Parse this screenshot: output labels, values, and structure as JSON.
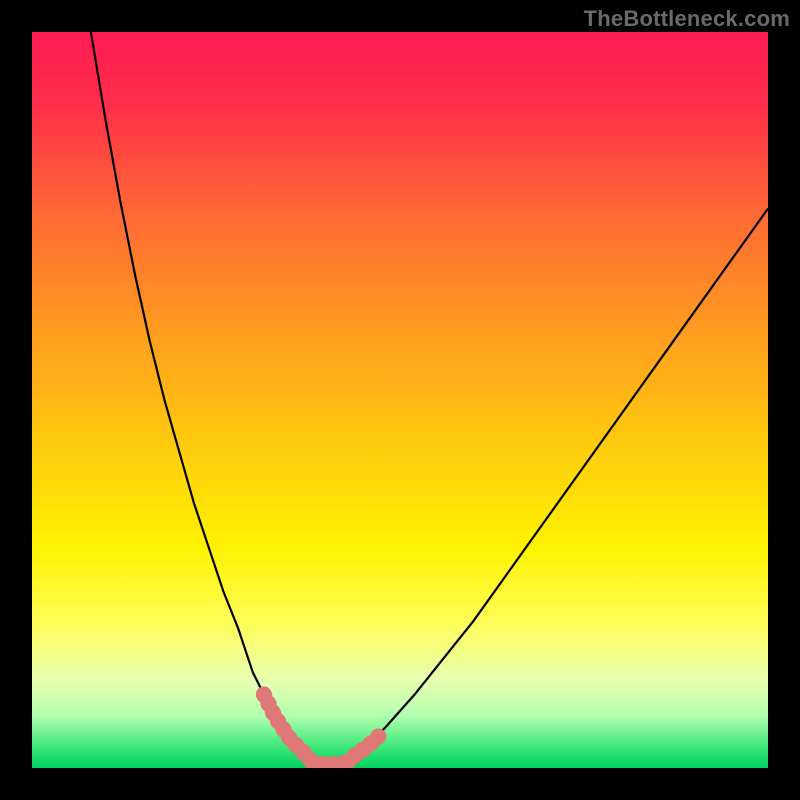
{
  "watermark": "TheBottleneck.com",
  "chart_data": {
    "type": "line",
    "title": "",
    "xlabel": "",
    "ylabel": "",
    "xlim": [
      0,
      100
    ],
    "ylim": [
      0,
      100
    ],
    "grid": false,
    "legend": false,
    "series": [
      {
        "name": "curve-left",
        "x": [
          8,
          10,
          12,
          14,
          16,
          18,
          20,
          22,
          24,
          26,
          28,
          29,
          30,
          31.5,
          33,
          35,
          37,
          38.07
        ],
        "values": [
          100,
          88,
          77,
          67,
          58,
          50,
          43,
          36,
          30,
          24,
          19,
          16,
          13,
          10,
          7,
          4,
          2,
          0.74
        ]
      },
      {
        "name": "plateau",
        "x": [
          38.07,
          39,
          40,
          41,
          42,
          42.79
        ],
        "values": [
          0.74,
          0.55,
          0.5,
          0.55,
          0.6,
          0.74
        ]
      },
      {
        "name": "curve-right",
        "x": [
          42.79,
          45,
          48,
          52,
          56,
          60,
          65,
          70,
          75,
          80,
          85,
          90,
          95,
          100
        ],
        "values": [
          0.74,
          2.5,
          5.5,
          10,
          15,
          20,
          27,
          34,
          41,
          48,
          55,
          62,
          69,
          76
        ]
      },
      {
        "name": "highlight-left",
        "x": [
          31.5,
          33,
          35,
          37,
          38.07
        ],
        "values": [
          10,
          7,
          4,
          2,
          0.74
        ]
      },
      {
        "name": "highlight-bottom",
        "x": [
          38.07,
          39,
          40,
          41,
          42,
          42.79
        ],
        "values": [
          0.74,
          0.55,
          0.5,
          0.55,
          0.6,
          0.74
        ]
      },
      {
        "name": "highlight-right",
        "x": [
          42.79,
          44,
          45,
          46,
          47,
          47.22
        ],
        "values": [
          0.74,
          1.8,
          2.5,
          3.3,
          4.2,
          4.55
        ]
      }
    ],
    "background_gradient": {
      "stops": [
        {
          "offset": 0.0,
          "color": "#ff1a54"
        },
        {
          "offset": 0.1,
          "color": "#ff2f4a"
        },
        {
          "offset": 0.25,
          "color": "#ff6a34"
        },
        {
          "offset": 0.4,
          "color": "#ff9a20"
        },
        {
          "offset": 0.55,
          "color": "#ffc80e"
        },
        {
          "offset": 0.7,
          "color": "#fff200"
        },
        {
          "offset": 0.8,
          "color": "#fffd55"
        },
        {
          "offset": 0.88,
          "color": "#e8ffb0"
        },
        {
          "offset": 0.93,
          "color": "#b0ffb0"
        },
        {
          "offset": 0.97,
          "color": "#40e878"
        },
        {
          "offset": 1.0,
          "color": "#00d060"
        }
      ]
    },
    "styles": {
      "curve": {
        "stroke": "#000000",
        "width": 2.2
      },
      "highlight": {
        "stroke": "#e07878",
        "width": 16,
        "dash": "1 9",
        "cap": "round"
      }
    }
  }
}
